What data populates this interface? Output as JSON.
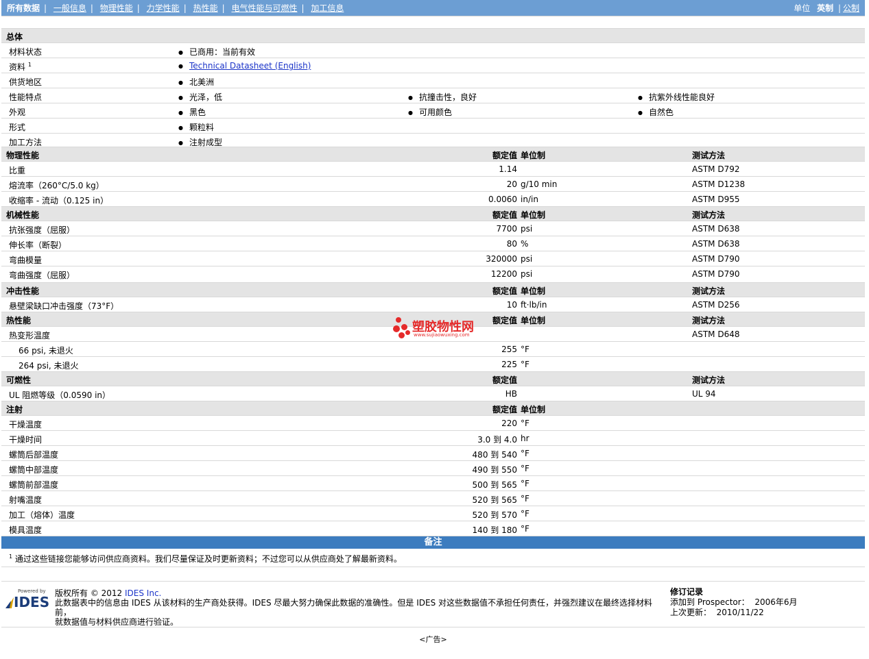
{
  "nav": {
    "items": [
      "所有数据",
      "一般信息",
      "物理性能",
      "力学性能",
      "热性能",
      "电气性能与可燃性",
      "加工信息"
    ],
    "units_label": "单位",
    "unit_imperial": "英制",
    "unit_metric": "公制"
  },
  "general": {
    "title": "总体",
    "status_label": "材料状态",
    "status_value": "已商用：当前有效",
    "docs_label": "资料",
    "docs_sup": "1",
    "docs_link": "Technical Datasheet (English)",
    "region_label": "供货地区",
    "region_value": "北美洲",
    "features_label": "性能特点",
    "features": [
      "光泽，低",
      "抗撞击性，良好",
      "抗紫外线性能良好"
    ],
    "appearance_label": "外观",
    "appearance": [
      "黑色",
      "可用颜色",
      "自然色"
    ],
    "form_label": "形式",
    "form_value": "颗粒料",
    "process_label": "加工方法",
    "process_value": "注射成型"
  },
  "cols": {
    "nominal": "额定值",
    "unit": "单位制",
    "method": "测试方法"
  },
  "physical": {
    "title": "物理性能",
    "rows": [
      {
        "label": "比重",
        "value": "1.14",
        "unit": "",
        "method": "ASTM D792"
      },
      {
        "label": "熔流率（260°C/5.0 kg）",
        "value": "20",
        "unit": "g/10 min",
        "method": "ASTM D1238"
      },
      {
        "label": "收缩率 - 流动（0.125 in）",
        "value": "0.0060",
        "unit": "in/in",
        "method": "ASTM D955"
      }
    ]
  },
  "mechanical": {
    "title": "机械性能",
    "rows": [
      {
        "label": "抗张强度（屈服）",
        "value": "7700",
        "unit": "psi",
        "method": "ASTM D638"
      },
      {
        "label": "伸长率（断裂）",
        "value": "80",
        "unit": "%",
        "method": "ASTM D638"
      },
      {
        "label": "弯曲模量",
        "value": "320000",
        "unit": "psi",
        "method": "ASTM D790"
      },
      {
        "label": "弯曲强度（屈服）",
        "value": "12200",
        "unit": "psi",
        "method": "ASTM D790"
      }
    ]
  },
  "impact": {
    "title": "冲击性能",
    "rows": [
      {
        "label": "悬壁梁缺口冲击强度（73°F）",
        "value": "10",
        "unit": "ft·lb/in",
        "method": "ASTM D256"
      }
    ]
  },
  "thermal": {
    "title": "热性能",
    "rows": [
      {
        "label": "热变形温度",
        "value": "",
        "unit": "",
        "method": "ASTM D648"
      },
      {
        "label": "66 psi, 未退火",
        "value": "255",
        "unit": "°F",
        "method": ""
      },
      {
        "label": "264 psi, 未退火",
        "value": "225",
        "unit": "°F",
        "method": ""
      }
    ]
  },
  "flammability": {
    "title": "可燃性",
    "rows": [
      {
        "label": "UL 阻燃等级（0.0590 in）",
        "value": "HB",
        "unit": "",
        "method": "UL 94"
      }
    ]
  },
  "injection": {
    "title": "注射",
    "rows": [
      {
        "label": "干燥温度",
        "value": "220",
        "unit": "°F"
      },
      {
        "label": "干燥时间",
        "value": "3.0 到  4.0",
        "unit": "hr"
      },
      {
        "label": "螺筒后部温度",
        "value": "480 到  540",
        "unit": "°F"
      },
      {
        "label": "螺筒中部温度",
        "value": "490 到  550",
        "unit": "°F"
      },
      {
        "label": "螺筒前部温度",
        "value": "500 到  565",
        "unit": "°F"
      },
      {
        "label": "射嘴温度",
        "value": "520 到  565",
        "unit": "°F"
      },
      {
        "label": "加工（熔体）温度",
        "value": "520 到  570",
        "unit": "°F"
      },
      {
        "label": "模具温度",
        "value": "140 到  180",
        "unit": "°F"
      }
    ]
  },
  "remarks": {
    "title": "备注",
    "sup": "1",
    "text": "通过这些链接您能够访问供应商资料。我们尽量保证及时更新资料；不过您可以从供应商处了解最新资料。"
  },
  "footer": {
    "logo_powered": "Powered by",
    "logo_text": "IDES",
    "copyright": "版权所有 © 2012",
    "company_link": "IDES Inc.",
    "disclaimer1": "此数据表中的信息由 IDES 从该材料的生产商处获得。IDES 尽最大努力确保此数据的准确性。但是 IDES 对这些数据值不承担任何责任，并强烈建议在最终选择材料前，",
    "disclaimer2": "就数据值与材料供应商进行验证。",
    "rev_title": "修订记录",
    "added_label": "添加到 Prospector：",
    "added_date": "2006年6月",
    "updated_label": "上次更新：",
    "updated_date": "2010/11/22"
  },
  "ad": "<广告>",
  "watermark": {
    "title": "塑胶物性网",
    "url": "www.sujiaowuxing.com"
  },
  "colors": {
    "topbar": "#6c9ed3",
    "remarks_bar": "#3c7cbf",
    "section_bg": "#e4e4e4",
    "link": "#1a33c8",
    "watermark": "#e52a2a"
  }
}
